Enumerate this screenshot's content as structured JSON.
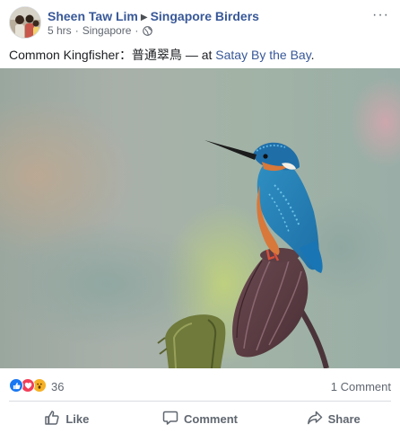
{
  "post": {
    "author": "Sheen Taw Lim",
    "group": "Singapore Birders",
    "time": "5 hrs",
    "separator": "·",
    "location": "Singapore",
    "caption_text": "Common Kingfisher：普通翠鳥 — at ",
    "caption_place": "Satay By the Bay",
    "caption_end": ".",
    "more_label": "···"
  },
  "photo": {
    "subject": "kingfisher perched on lotus seed pod",
    "icon": "photo-image"
  },
  "reactions": {
    "types": [
      "like",
      "love",
      "wow"
    ],
    "count": "36",
    "comments": "1 Comment"
  },
  "actions": {
    "like": "Like",
    "comment": "Comment",
    "share": "Share"
  },
  "colors": {
    "link": "#385898",
    "muted": "#606770",
    "like": "#1877f2",
    "love": "#f33e58",
    "wow": "#f7b125"
  }
}
